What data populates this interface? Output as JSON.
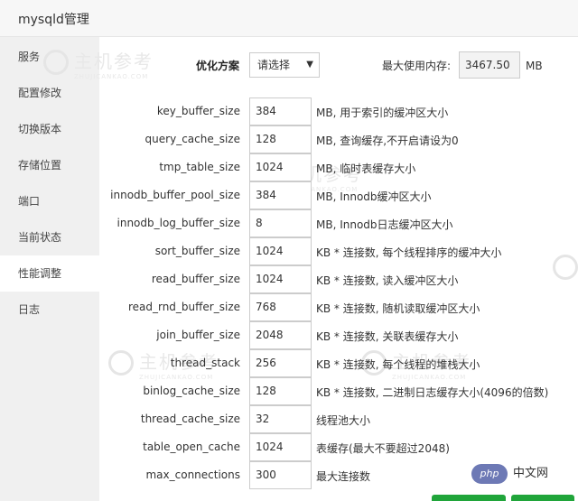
{
  "window": {
    "title": "mysqld管理"
  },
  "sidebar": {
    "items": [
      {
        "label": "服务"
      },
      {
        "label": "配置修改"
      },
      {
        "label": "切换版本"
      },
      {
        "label": "存储位置"
      },
      {
        "label": "端口"
      },
      {
        "label": "当前状态"
      },
      {
        "label": "性能调整",
        "active": true
      },
      {
        "label": "日志"
      }
    ]
  },
  "toolbar": {
    "optimize_label": "优化方案",
    "optimize_select": "请选择",
    "max_memory_label": "最大使用内存:",
    "max_memory_value": "3467.50",
    "max_memory_unit": "MB"
  },
  "params": [
    {
      "name": "key_buffer_size",
      "value": "384",
      "desc": "MB, 用于索引的缓冲区大小"
    },
    {
      "name": "query_cache_size",
      "value": "128",
      "desc": "MB, 查询缓存,不开启请设为0"
    },
    {
      "name": "tmp_table_size",
      "value": "1024",
      "desc": "MB, 临时表缓存大小"
    },
    {
      "name": "innodb_buffer_pool_size",
      "value": "384",
      "desc": "MB, Innodb缓冲区大小"
    },
    {
      "name": "innodb_log_buffer_size",
      "value": "8",
      "desc": "MB, Innodb日志缓冲区大小"
    },
    {
      "name": "sort_buffer_size",
      "value": "1024",
      "desc": "KB * 连接数, 每个线程排序的缓冲大小"
    },
    {
      "name": "read_buffer_size",
      "value": "1024",
      "desc": "KB * 连接数, 读入缓冲区大小"
    },
    {
      "name": "read_rnd_buffer_size",
      "value": "768",
      "desc": "KB * 连接数, 随机读取缓冲区大小"
    },
    {
      "name": "join_buffer_size",
      "value": "2048",
      "desc": "KB * 连接数, 关联表缓存大小"
    },
    {
      "name": "thread_stack",
      "value": "256",
      "desc": "KB * 连接数, 每个线程的堆栈大小"
    },
    {
      "name": "binlog_cache_size",
      "value": "128",
      "desc": "KB * 连接数, 二进制日志缓存大小(4096的倍数)"
    },
    {
      "name": "thread_cache_size",
      "value": "32",
      "desc": "线程池大小"
    },
    {
      "name": "table_open_cache",
      "value": "1024",
      "desc": "表缓存(最大不要超过2048)"
    },
    {
      "name": "max_connections",
      "value": "300",
      "desc": "最大连接数"
    }
  ],
  "watermark": {
    "text": "主机参考",
    "sub": "ZHUJICANKAO.COM"
  },
  "badge": {
    "php": "php",
    "zh": "中文网"
  },
  "colors": {
    "accent_green": "#20a53a",
    "php_badge": "#6d79b5"
  }
}
